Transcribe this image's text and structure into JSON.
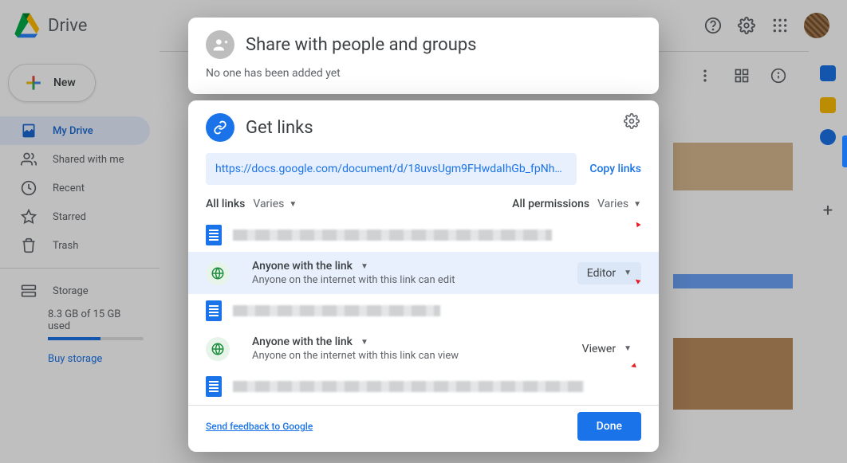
{
  "header": {
    "app_name": "Drive"
  },
  "sidebar": {
    "new_label": "New",
    "items": [
      {
        "label": "My Drive",
        "icon": "my-drive-icon",
        "active": true
      },
      {
        "label": "Shared with me",
        "icon": "shared-icon"
      },
      {
        "label": "Recent",
        "icon": "recent-icon"
      },
      {
        "label": "Starred",
        "icon": "star-icon"
      },
      {
        "label": "Trash",
        "icon": "trash-icon"
      }
    ],
    "storage_label": "Storage",
    "storage_used": "8.3 GB of 15 GB used",
    "buy_storage": "Buy storage"
  },
  "share_dialog": {
    "title": "Share with people and groups",
    "subtitle": "No one has been added yet"
  },
  "links_dialog": {
    "title": "Get links",
    "url": "https://docs.google.com/document/d/18uvsUgm9FHwdaIhGb_fpNhD5mQ...",
    "copy_label": "Copy links",
    "all_links_label": "All links",
    "all_links_value": "Varies",
    "all_perms_label": "All permissions",
    "all_perms_value": "Varies",
    "items": [
      {
        "scope_title": "Anyone with the link",
        "scope_sub": "Anyone on the internet with this link can edit",
        "role": "Editor"
      },
      {
        "scope_title": "Anyone with the link",
        "scope_sub": "Anyone on the internet with this link can view",
        "role": "Viewer"
      }
    ],
    "feedback": "Send feedback to Google",
    "done": "Done"
  }
}
